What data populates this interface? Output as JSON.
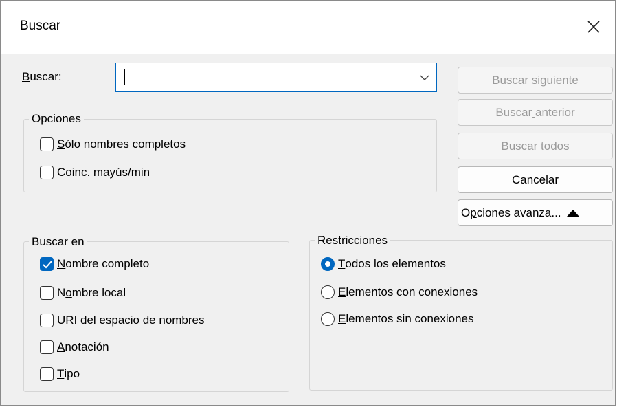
{
  "window": {
    "title": "Buscar",
    "close_icon": "close-icon"
  },
  "search": {
    "label_hot": "B",
    "label_rest": "uscar:",
    "value": "",
    "placeholder": ""
  },
  "buttons": {
    "find_next": {
      "pre": "Buscar si",
      "hot": "g",
      "post": "uiente",
      "enabled": false
    },
    "find_prev": {
      "pre": "Buscar",
      "hot": " ",
      "post": "anterior",
      "enabled": false
    },
    "find_all": {
      "pre": "Buscar to",
      "hot": "d",
      "post": "os",
      "enabled": false
    },
    "cancel": {
      "label": "Cancelar",
      "enabled": true
    },
    "advanced": {
      "pre": "O",
      "hot": "p",
      "post": "ciones avanza...",
      "enabled": true
    }
  },
  "options": {
    "title": "Opciones",
    "items": [
      {
        "hot": "S",
        "rest": "ólo nombres completos",
        "checked": false
      },
      {
        "hot": "C",
        "rest": "oinc. mayús/min",
        "checked": false
      }
    ]
  },
  "search_in": {
    "title": "Buscar en",
    "items": [
      {
        "hot": "N",
        "rest": "ombre completo",
        "checked": true
      },
      {
        "pre": "N",
        "hot": "o",
        "rest": "mbre local",
        "checked": false
      },
      {
        "hot": "U",
        "rest": "RI del espacio de nombres",
        "checked": false
      },
      {
        "hot": "A",
        "rest": "notación",
        "checked": false
      },
      {
        "hot": "T",
        "rest": "ipo",
        "checked": false
      }
    ]
  },
  "restrictions": {
    "title": "Restricciones",
    "items": [
      {
        "hot": "T",
        "rest": "odos los elementos",
        "selected": true
      },
      {
        "hot": "E",
        "rest": "lementos con conexiones",
        "selected": false
      },
      {
        "hot": "E",
        "rest": "lementos sin conexiones",
        "selected": false
      }
    ]
  },
  "colors": {
    "accent": "#0067c0",
    "dialog_bg": "#f0f0f0",
    "disabled_text": "#9a9a9a"
  }
}
